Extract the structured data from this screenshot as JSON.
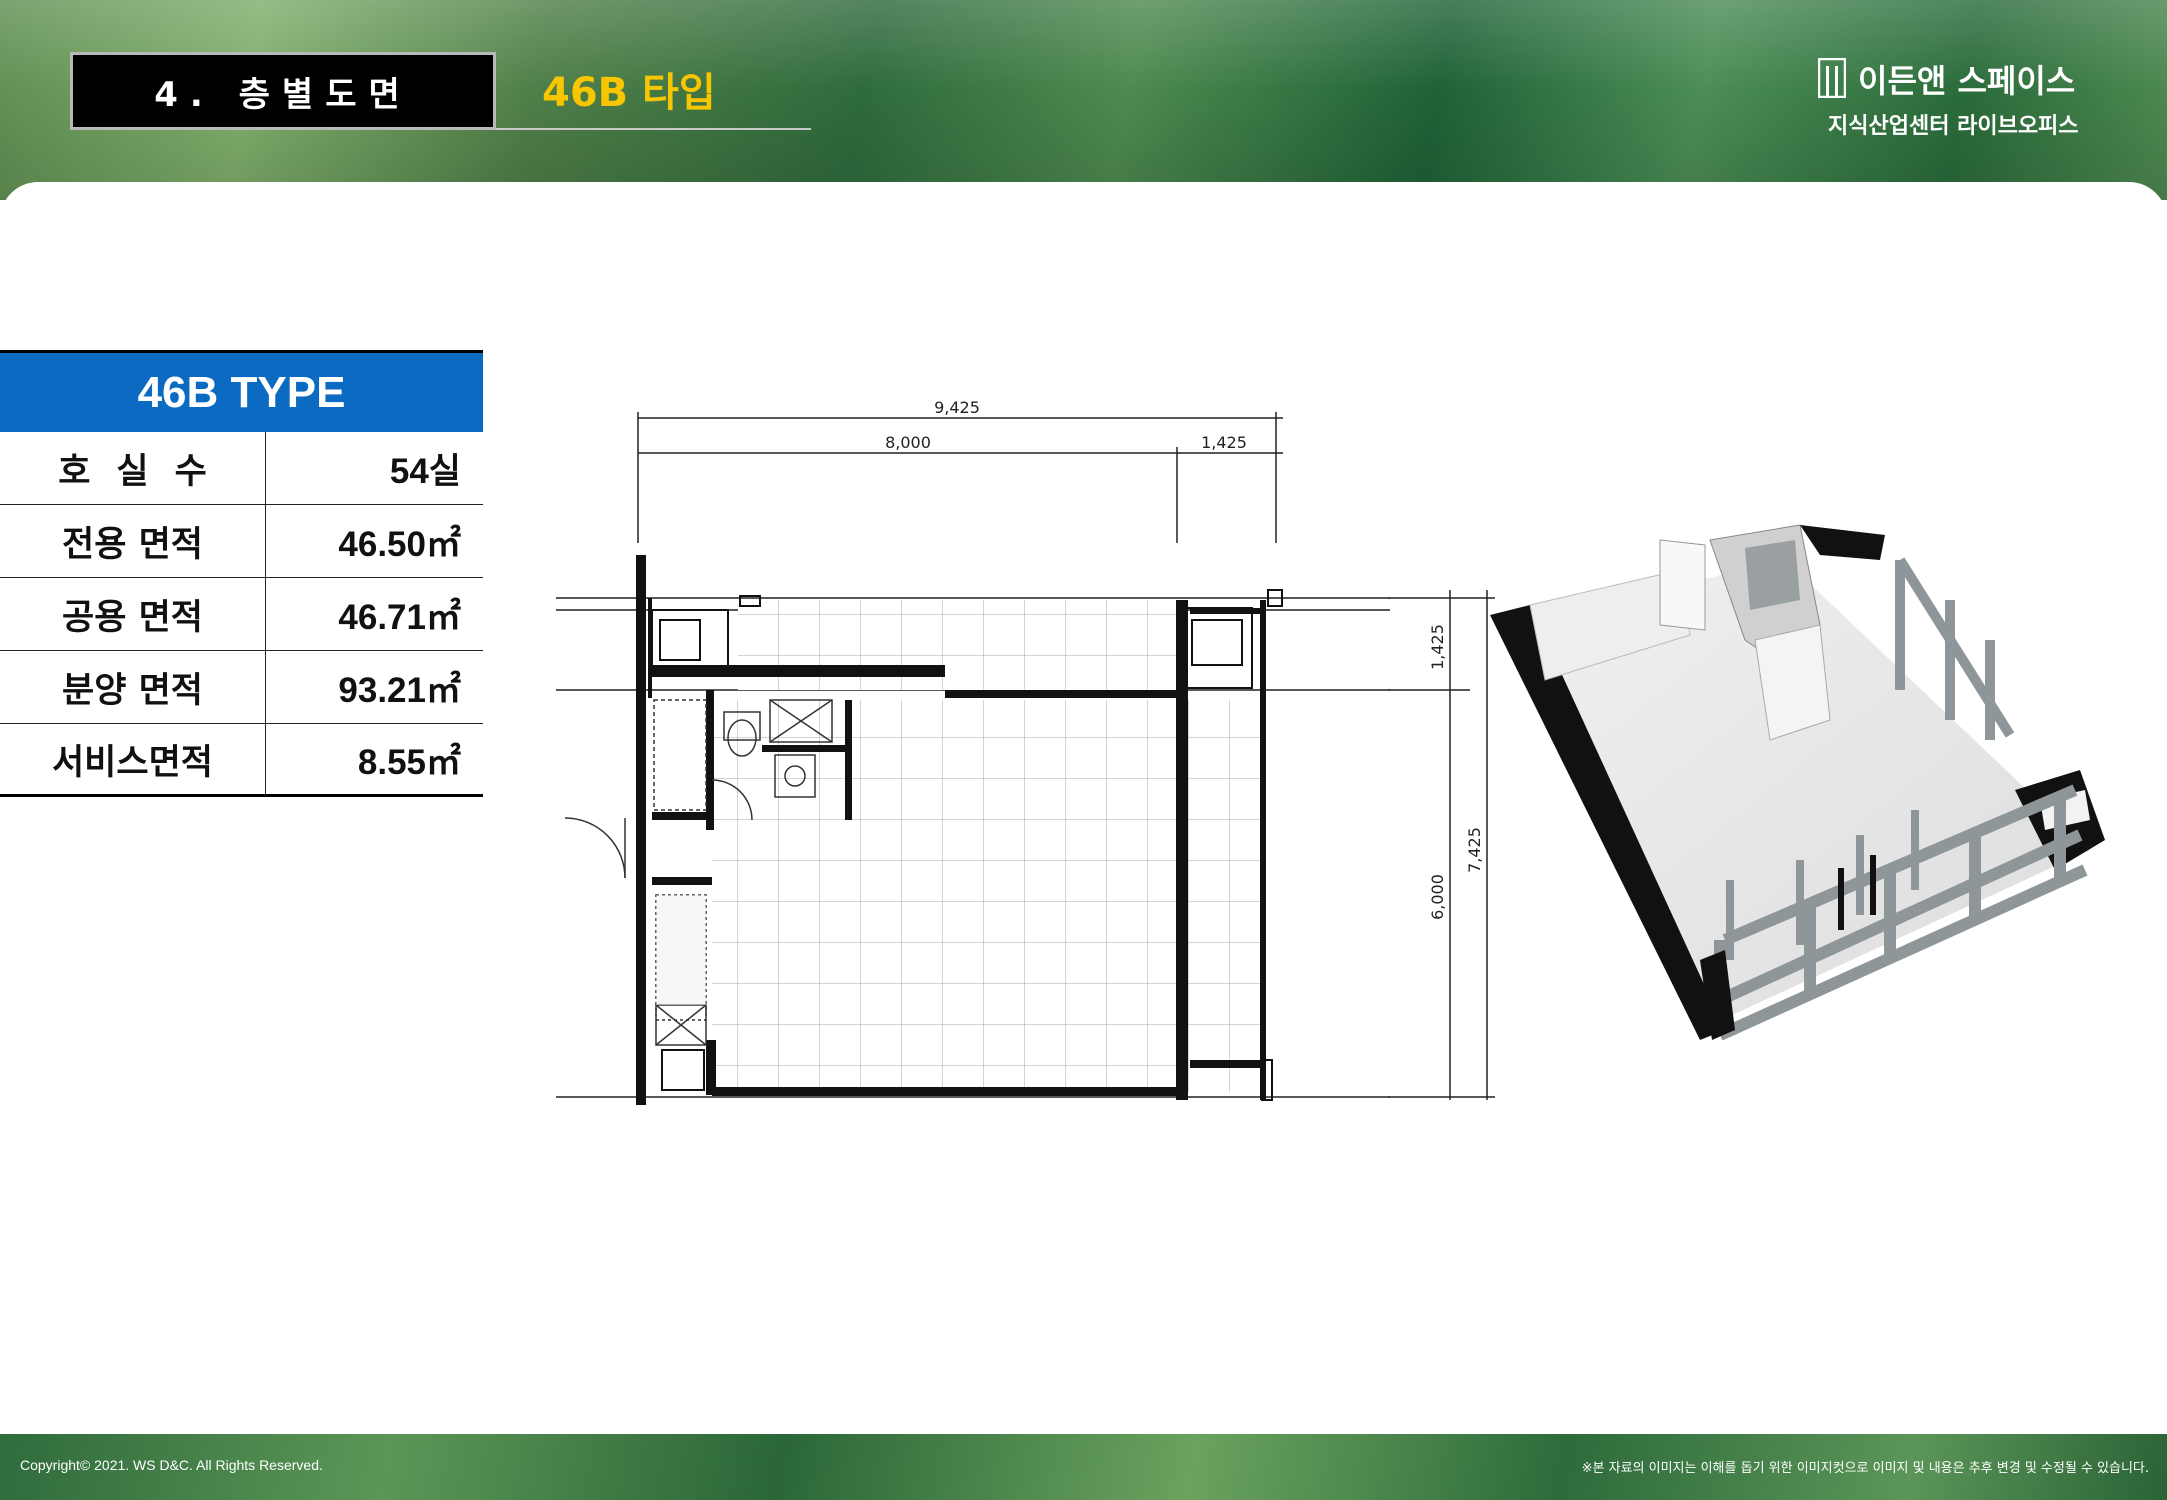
{
  "header": {
    "section_label": "4. 층별도면",
    "type_title": "46B 타입",
    "brand_name": "이든앤 스페이스",
    "brand_sub": "지식산업센터 라이브오피스"
  },
  "spec": {
    "title": "46B TYPE",
    "rows": [
      {
        "label": "호실수",
        "value": "54실"
      },
      {
        "label": "전용 면적",
        "value": "46.50㎡"
      },
      {
        "label": "공용 면적",
        "value": "46.71㎡"
      },
      {
        "label": "분양 면적",
        "value": "93.21㎡"
      },
      {
        "label": "서비스면적",
        "value": "8.55㎡"
      }
    ]
  },
  "floorplan": {
    "dim_total_width": "9,425",
    "dim_width_main": "8,000",
    "dim_width_side": "1,425",
    "dim_height_top": "1,425",
    "dim_height_main": "6,000",
    "dim_height_total": "7,425"
  },
  "footer": {
    "copyright": "Copyright© 2021. WS D&C. All Rights Reserved.",
    "disclaimer": "※본 자료의 이미지는 이해를 돕기 위한 이미지컷으로 이미지 및 내용은 추후 변경 및 수정될 수 있습니다."
  },
  "colors": {
    "accent_yellow": "#f7c600",
    "table_blue": "#0b6bc2",
    "brand_green": "#2f6b3c"
  }
}
